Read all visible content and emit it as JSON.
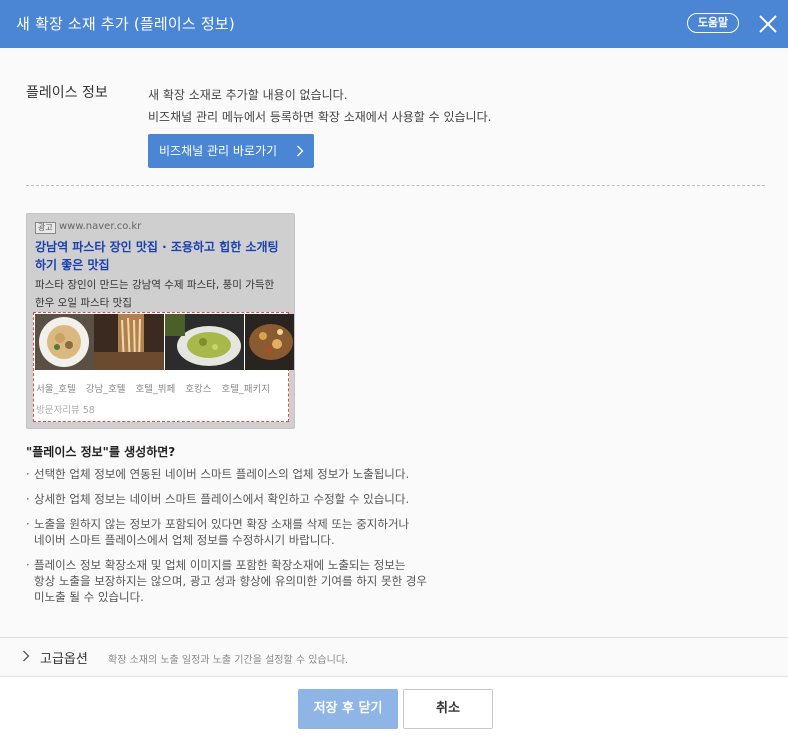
{
  "header": {
    "title": "새 확장 소재 추가 (플레이스 정보)",
    "help_label": "도움말"
  },
  "section": {
    "label": "플레이스 정보",
    "notice_line1": "새 확장 소재로 추가할 내용이 없습니다.",
    "notice_line2": "비즈채널 관리 메뉴에서 등록하면 확장 소재에서 사용할 수 있습니다.",
    "biz_button_label": "비즈채널 관리 바로가기"
  },
  "preview": {
    "ad_tag": "광고",
    "url": "www.naver.co.kr",
    "title_line1": "강남역 파스타 장인 맛집 · 조용하고 힙한 소개팅",
    "title_line2": "하기 좋은 맛집",
    "desc_line1": "파스타 장인이 만드는 강남역 수제 파스타, 풍미 가득한",
    "desc_line2": "한우 오일 파스타 맛집",
    "tags": [
      "서울_호텔",
      "강남_호텔",
      "호텔_뷔페",
      "호캉스",
      "호텔_패키지"
    ],
    "visitor_reviews": "방문자리뷰 58"
  },
  "info": {
    "title": "\"플레이스 정보\"를 생성하면?",
    "items": [
      {
        "line1": "선택한 업체 정보에 연동된 네이버 스마트 플레이스의 업체 정보가 노출됩니다."
      },
      {
        "line1": "상세한 업체 정보는 네이버 스마트 플레이스에서 확인하고 수정할 수 있습니다."
      },
      {
        "line1": "노출을 원하지 않는 정보가 포함되어 있다면 확장 소재를 삭제 또는 중지하거나",
        "line2": "네이버 스마트 플레이스에서 업체 정보를 수정하시기 바랍니다."
      },
      {
        "line1": "플레이스 정보 확장소재 및 업체 이미지를 포함한 확장소재에 노출되는 정보는",
        "line2": "항상 노출을 보장하지는 않으며, 광고 성과 향상에 유의미한 기여를 하지 못한 경우",
        "line3": "미노출 될 수 있습니다."
      }
    ]
  },
  "advanced": {
    "label": "고급옵션",
    "description": "확장 소재의 노출 일정과 노출 기간을 설정할 수 있습니다."
  },
  "footer": {
    "save_label": "저장 후 닫기",
    "cancel_label": "취소"
  },
  "colors": {
    "header_bg": "#4a86d4",
    "primary_button": "#4a86d4",
    "save_button_disabled": "#8fb4e6",
    "ad_title": "#1a3fb0"
  }
}
